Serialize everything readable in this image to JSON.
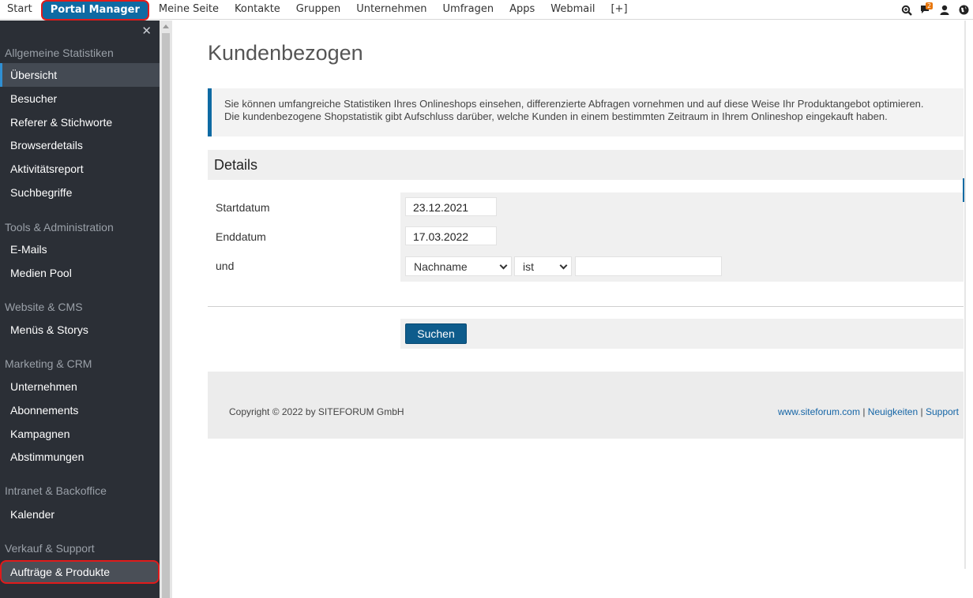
{
  "topnav": {
    "items": [
      "Start",
      "Portal Manager",
      "Meine Seite",
      "Kontakte",
      "Gruppen",
      "Unternehmen",
      "Umfragen",
      "Apps",
      "Webmail",
      "[+]"
    ],
    "active_index": 1,
    "notification_count": "2",
    "icons": [
      "search-zoom-icon",
      "chat-icon",
      "user-icon",
      "globe-icon"
    ]
  },
  "sidebar": {
    "close_label": "✕",
    "sections": [
      {
        "title": "Allgemeine Statistiken",
        "items": [
          "Übersicht",
          "Besucher",
          "Referer & Stichworte",
          "Browserdetails",
          "Aktivitätsreport",
          "Suchbegriffe"
        ]
      },
      {
        "title": "Tools & Administration",
        "items": [
          "E-Mails",
          "Medien Pool"
        ]
      },
      {
        "title": "Website & CMS",
        "items": [
          "Menüs & Storys"
        ]
      },
      {
        "title": "Marketing & CRM",
        "items": [
          "Unternehmen",
          "Abonnements",
          "Kampagnen",
          "Abstimmungen"
        ]
      },
      {
        "title": "Intranet & Backoffice",
        "items": [
          "Kalender"
        ]
      },
      {
        "title": "Verkauf & Support",
        "items": [
          "Aufträge & Produkte"
        ]
      }
    ],
    "active_item": "Übersicht",
    "highlighted_item": "Aufträge & Produkte"
  },
  "main": {
    "title": "Kundenbezogen",
    "info_line1": "Sie können umfangreiche Statistiken Ihres Onlineshops einsehen, differenzierte Abfragen vornehmen und auf diese Weise Ihr Produktangebot optimieren.",
    "info_line2": "Die kundenbezogene Shopstatistik gibt Aufschluss darüber, welche Kunden in einem bestimmten Zeitraum in Ihrem Onlineshop eingekauft haben.",
    "details_title": "Details",
    "form": {
      "start_label": "Startdatum",
      "start_value": "23.12.2021",
      "end_label": "Enddatum",
      "end_value": "17.03.2022",
      "and_label": "und",
      "field_select": "Nachname",
      "operator_select": "ist",
      "filter_value": ""
    },
    "search_button": "Suchen"
  },
  "footer": {
    "copyright": "Copyright © 2022 by SITEFORUM GmbH",
    "link1": "www.siteforum.com",
    "sep": "|",
    "link2": "Neuigkeiten",
    "link3": "Support"
  },
  "colors": {
    "accent": "#0e6aa3",
    "sidebar_bg": "#2b2f36",
    "highlight": "#e01b1b",
    "badge": "#e8760b"
  }
}
